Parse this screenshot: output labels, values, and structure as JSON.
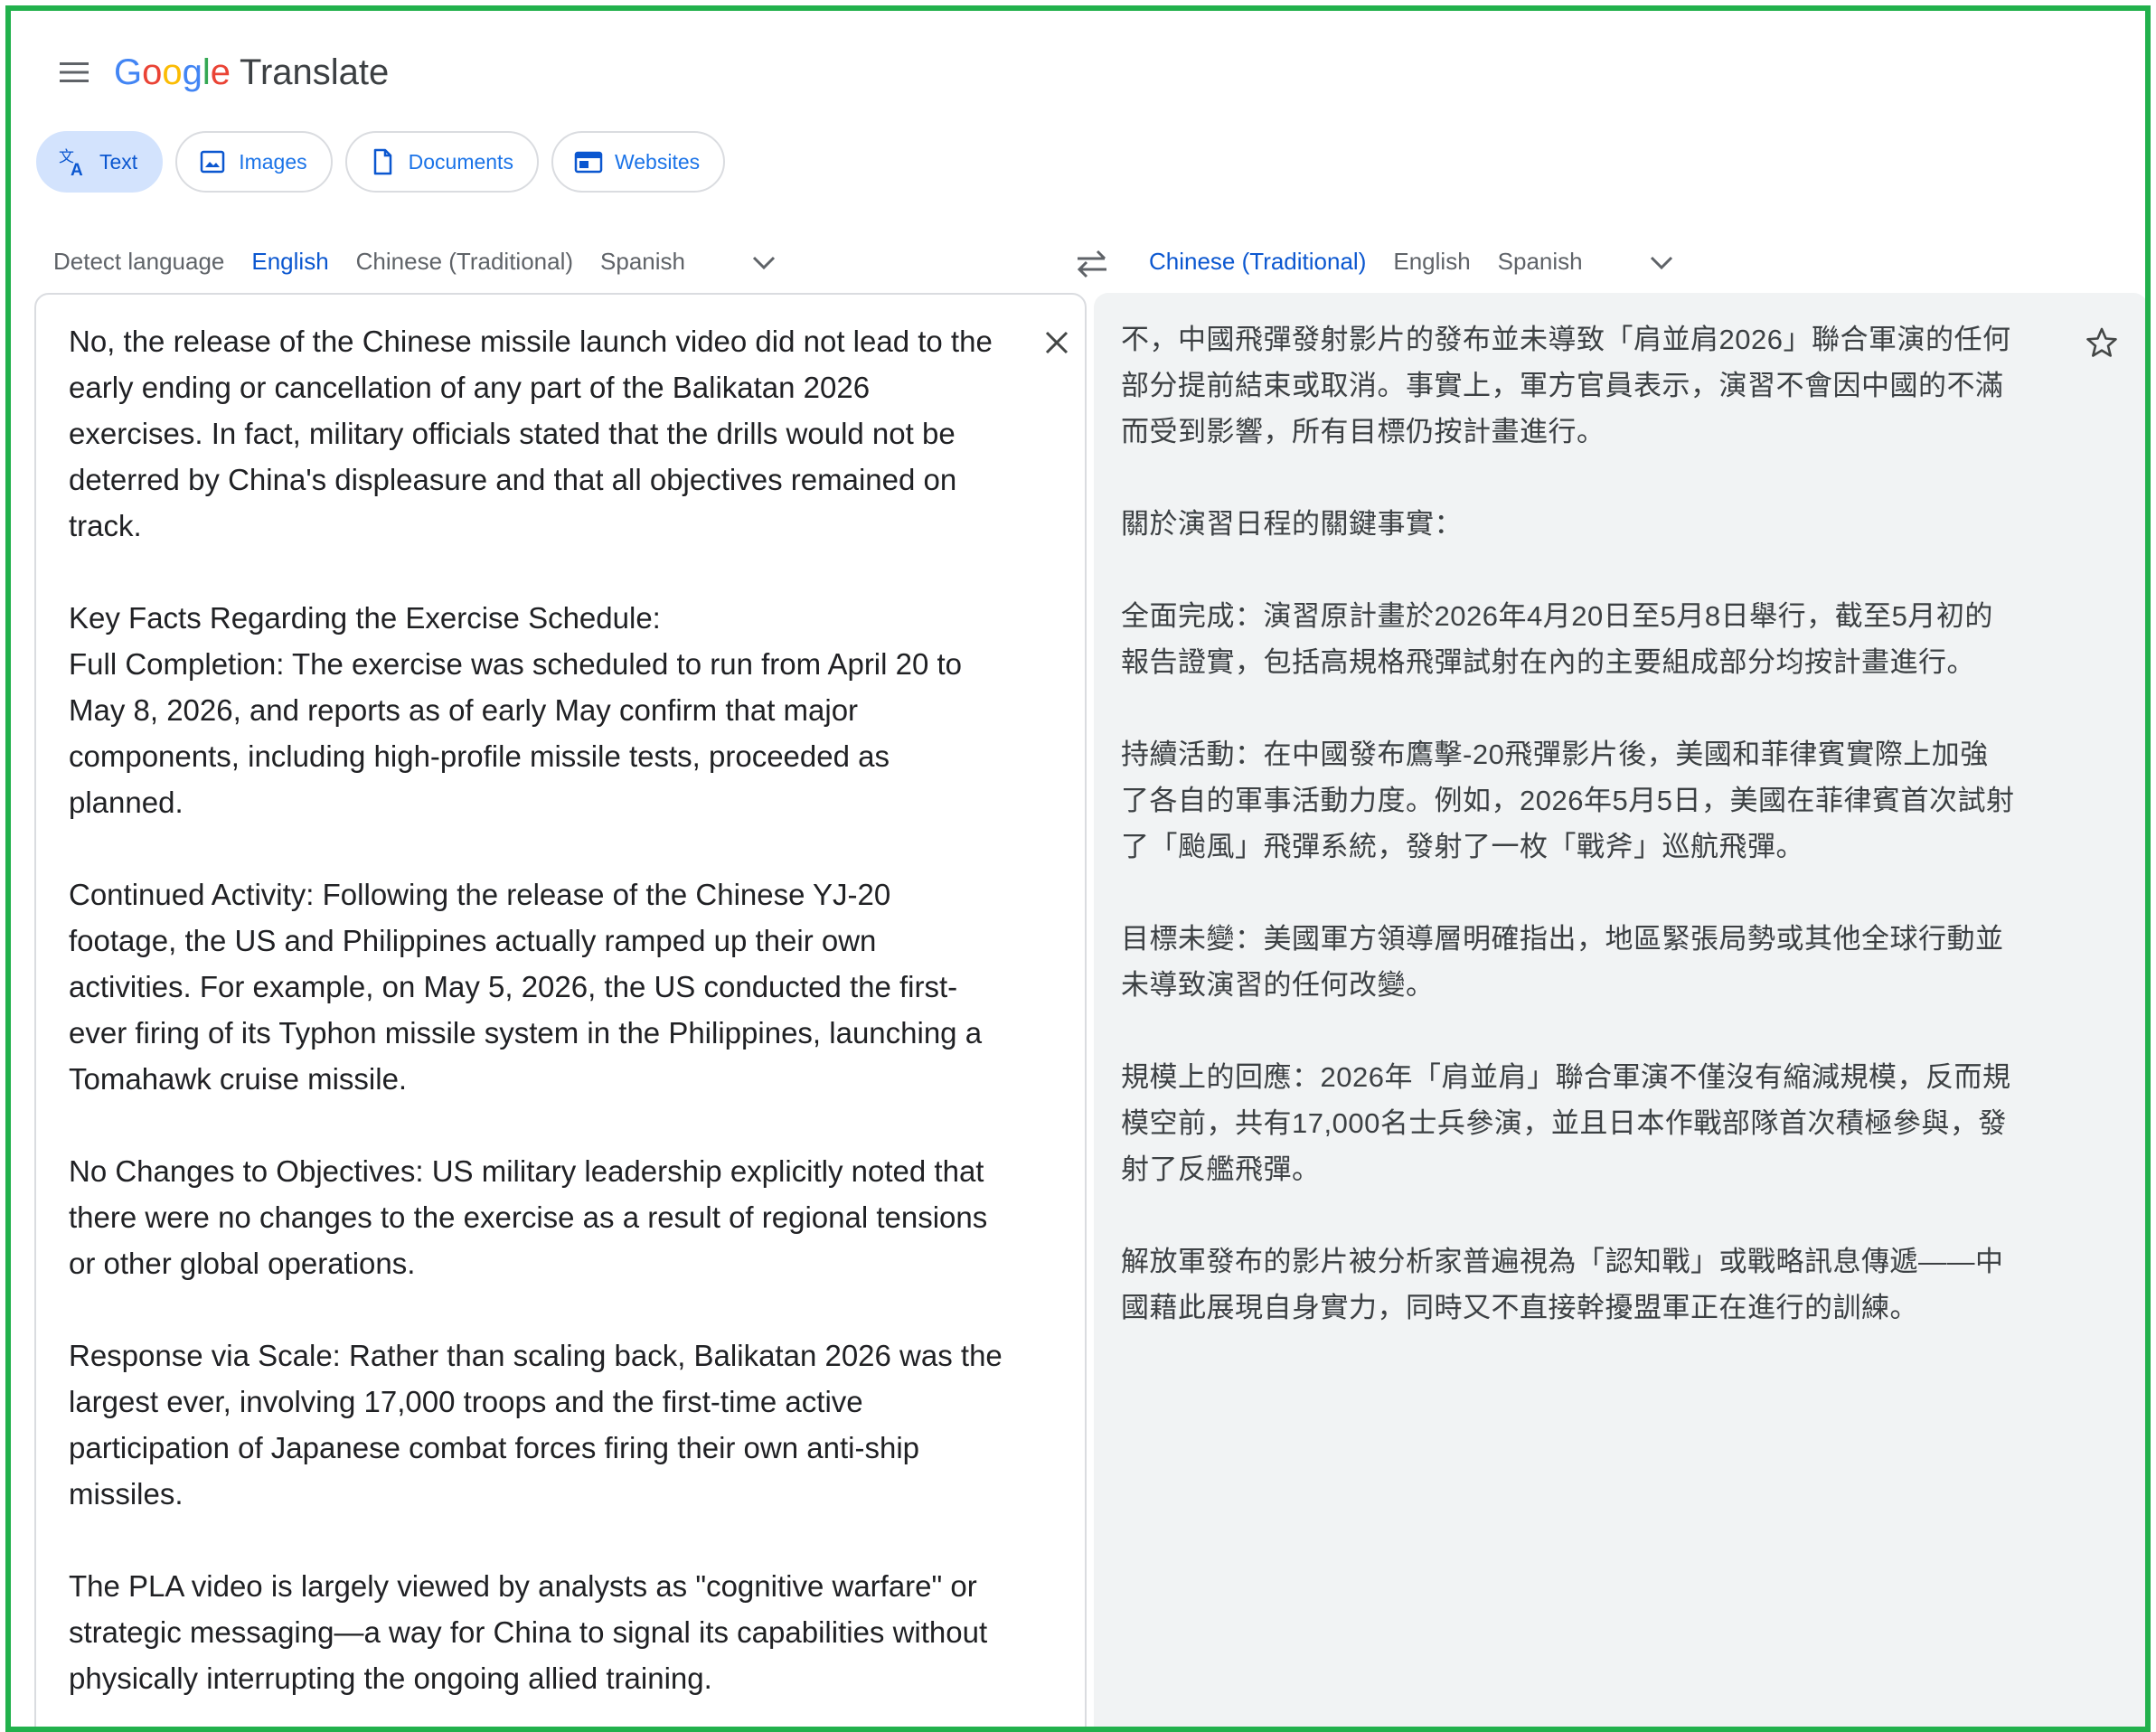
{
  "header": {
    "menu_icon": "hamburger-menu-icon",
    "logo_letters": [
      "G",
      "o",
      "o",
      "g",
      "l",
      "e"
    ],
    "logo_colors": [
      "#4285f4",
      "#ea4335",
      "#fbbc04",
      "#4285f4",
      "#34a853",
      "#ea4335"
    ],
    "product_name": "Translate"
  },
  "modes": [
    {
      "label": "Text",
      "icon": "translate-icon",
      "active": true
    },
    {
      "label": "Images",
      "icon": "image-icon",
      "active": false
    },
    {
      "label": "Documents",
      "icon": "document-icon",
      "active": false
    },
    {
      "label": "Websites",
      "icon": "website-icon",
      "active": false
    }
  ],
  "source_languages": [
    {
      "label": "Detect language",
      "active": false
    },
    {
      "label": "English",
      "active": true
    },
    {
      "label": "Chinese (Traditional)",
      "active": false
    },
    {
      "label": "Spanish",
      "active": false
    }
  ],
  "target_languages": [
    {
      "label": "Chinese (Traditional)",
      "active": true
    },
    {
      "label": "English",
      "active": false
    },
    {
      "label": "Spanish",
      "active": false
    }
  ],
  "source": {
    "text": "No, the release of the Chinese missile launch video did not lead to the\nearly ending or cancellation of any part of the Balikatan 2026\nexercises. In fact, military officials stated that the drills would not be\ndeterred by China's displeasure and that all objectives remained on\ntrack.\n\nKey Facts Regarding the Exercise Schedule:\nFull Completion: The exercise was scheduled to run from April 20 to\nMay 8, 2026, and reports as of early May confirm that major\ncomponents, including high-profile missile tests, proceeded as\nplanned.\n\nContinued Activity: Following the release of the Chinese YJ-20\nfootage, the US and Philippines actually ramped up their own\nactivities. For example, on May 5, 2026, the US conducted the first-\never firing of its Typhon missile system in the Philippines, launching a\nTomahawk cruise missile.\n\nNo Changes to Objectives: US military leadership explicitly noted that\nthere were no changes to the exercise as a result of regional tensions\nor other global operations.\n\nResponse via Scale: Rather than scaling back, Balikatan 2026 was the\nlargest ever, involving 17,000 troops and the first-time active\nparticipation of Japanese combat forces firing their own anti-ship\nmissiles.\n\nThe PLA video is largely viewed by analysts as \"cognitive warfare\" or\nstrategic messaging—a way for China to signal its capabilities without\nphysically interrupting the ongoing allied training."
  },
  "target": {
    "text": "不，中國飛彈發射影片的發布並未導致「肩並肩2026」聯合軍演的任何\n部分提前結束或取消。事實上，軍方官員表示，演習不會因中國的不滿\n而受到影響，所有目標仍按計畫進行。\n\n關於演習日程的關鍵事實：\n\n全面完成：演習原計畫於2026年4月20日至5月8日舉行，截至5月初的\n報告證實，包括高規格飛彈試射在內的主要組成部分均按計畫進行。\n\n持續活動：在中國發布鷹擊-20飛彈影片後，美國和菲律賓實際上加強\n了各自的軍事活動力度。例如，2026年5月5日，美國在菲律賓首次試射\n了「颱風」飛彈系統，發射了一枚「戰斧」巡航飛彈。\n\n目標未變：美國軍方領導層明確指出，地區緊張局勢或其他全球行動並\n未導致演習的任何改變。\n\n規模上的回應：2026年「肩並肩」聯合軍演不僅沒有縮減規模，反而規\n模空前，共有17,000名士兵參演，並且日本作戰部隊首次積極參與，發\n射了反艦飛彈。\n\n解放軍發布的影片被分析家普遍視為「認知戰」或戰略訊息傳遞——中\n國藉此展現自身實力，同時又不直接幹擾盟軍正在進行的訓練。"
  },
  "icons": {
    "swap": "swap-languages-icon",
    "more_languages": "chevron-down-icon",
    "clear": "close-icon",
    "save": "star-icon"
  },
  "colors": {
    "accent": "#0b57d0",
    "active_chip_bg": "#d3e3fd",
    "target_bg": "#f1f3f4",
    "frame_border": "#22b14c"
  }
}
